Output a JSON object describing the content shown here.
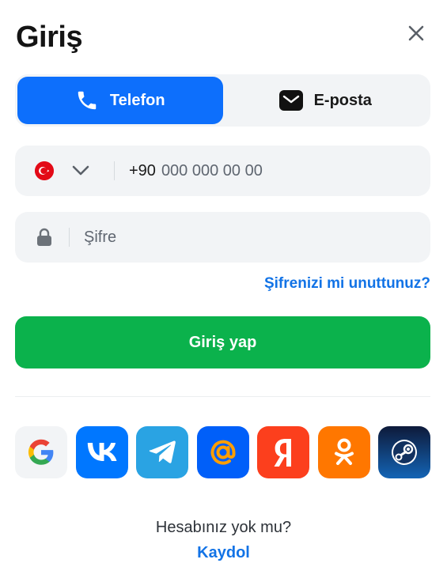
{
  "title": "Giriş",
  "tabs": {
    "phone_label": "Telefon",
    "email_label": "E-posta"
  },
  "phone": {
    "country_code": "+90",
    "placeholder": "000 000 00 00",
    "country_flag": "turkey-flag-icon"
  },
  "password": {
    "placeholder": "Şifre"
  },
  "forgot_link": "Şifrenizi mi unuttunuz?",
  "login_button": "Giriş yap",
  "socials": [
    "google",
    "vk",
    "telegram",
    "mail-ru",
    "yandex",
    "odnoklassniki",
    "steam"
  ],
  "signup": {
    "question": "Hesabınız yok mu?",
    "link": "Kaydol"
  },
  "colors": {
    "accent": "#0d6ffc",
    "success": "#0bb24c",
    "link": "#1273e6",
    "field_bg": "#f2f4f6"
  }
}
